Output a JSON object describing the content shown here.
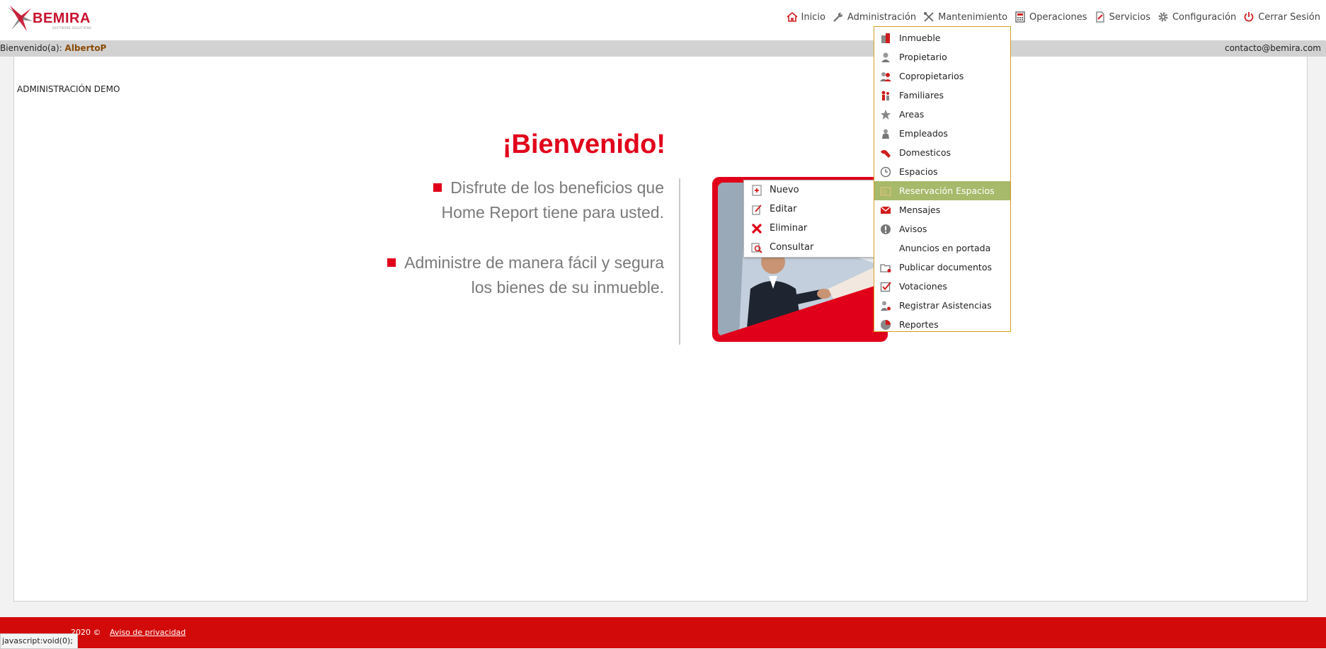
{
  "brand": {
    "name": "BEMIRA",
    "tagline": "SOFTWARE SOLUTIONS",
    "color": "#c8102e"
  },
  "nav": [
    {
      "label": "Inicio",
      "icon": "home-icon"
    },
    {
      "label": "Administración",
      "icon": "wrench-icon"
    },
    {
      "label": "Mantenimiento",
      "icon": "tools-icon"
    },
    {
      "label": "Operaciones",
      "icon": "calculator-icon"
    },
    {
      "label": "Servicios",
      "icon": "document-icon"
    },
    {
      "label": "Configuración",
      "icon": "gear-icon"
    },
    {
      "label": "Cerrar Sesión",
      "icon": "power-icon"
    }
  ],
  "welcome": {
    "prefix": "Bienvenido(a):",
    "user": "AlbertoP",
    "email": "contacto@bemira.com"
  },
  "main": {
    "section_label": "ADMINISTRACIÓN DEMO",
    "title": "¡Bienvenido!",
    "bullet1_line1": "Disfrute de los beneficios que",
    "bullet1_line2": "Home Report tiene para usted.",
    "bullet2_line1": "Administre de manera fácil y segura",
    "bullet2_line2": "los bienes de su inmueble."
  },
  "admin_menu": {
    "items": [
      {
        "label": "Inmueble",
        "icon": "building-icon"
      },
      {
        "label": "Propietario",
        "icon": "owner-icon"
      },
      {
        "label": "Copropietarios",
        "icon": "co-owners-icon"
      },
      {
        "label": "Familiares",
        "icon": "family-icon"
      },
      {
        "label": "Areas",
        "icon": "star-icon"
      },
      {
        "label": "Empleados",
        "icon": "employee-icon"
      },
      {
        "label": "Domesticos",
        "icon": "domestic-icon"
      },
      {
        "label": "Espacios",
        "icon": "clock-icon"
      },
      {
        "label": "Reservación Espacios",
        "icon": "reservation-icon"
      },
      {
        "label": "Mensajes",
        "icon": "envelope-icon"
      },
      {
        "label": "Avisos",
        "icon": "alert-icon"
      },
      {
        "label": "Anuncios en portada",
        "icon": ""
      },
      {
        "label": "Publicar documentos",
        "icon": "folder-icon"
      },
      {
        "label": "Votaciones",
        "icon": "checkbox-icon"
      },
      {
        "label": "Registrar Asistencias",
        "icon": "attendance-icon"
      },
      {
        "label": "Reportes",
        "icon": "report-icon"
      }
    ],
    "active": "Reservación Espacios"
  },
  "submenu": {
    "nuevo": "Nuevo",
    "editar": "Editar",
    "eliminar": "Eliminar",
    "consultar": "Consultar"
  },
  "footer": {
    "copyright": "2020 ©",
    "privacy": "Aviso de privacidad"
  },
  "status_bar": "javascript:void(0);",
  "colors": {
    "accent": "#e1001a",
    "footer": "#d20a0a",
    "menu_active": "#a7b96a",
    "menu_border": "#d4a020"
  }
}
